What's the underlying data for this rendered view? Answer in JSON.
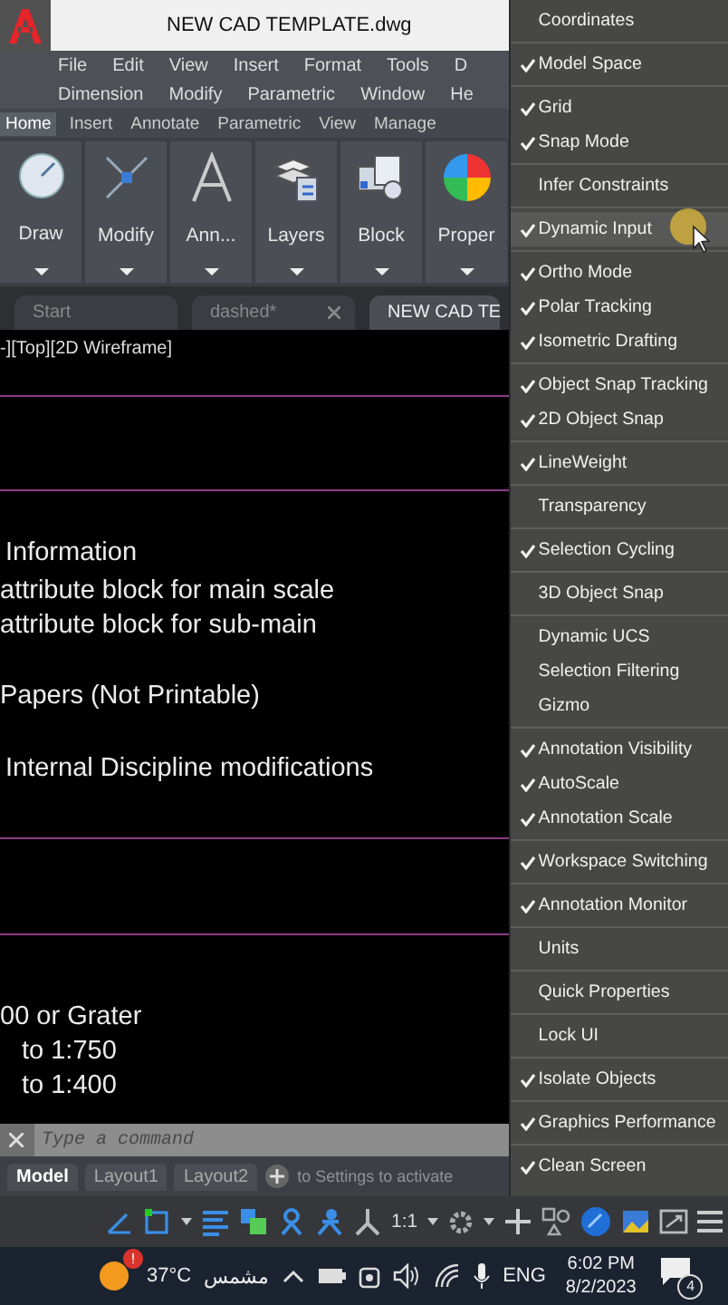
{
  "title_bar": {
    "title": "NEW CAD TEMPLATE.dwg"
  },
  "menu_rows": [
    {
      "items": [
        "File",
        "Edit",
        "View",
        "Insert",
        "Format",
        "Tools",
        "D"
      ]
    },
    {
      "items": [
        "Dimension",
        "Modify",
        "Parametric",
        "Window",
        "He"
      ]
    }
  ],
  "ribbon_tabs": [
    {
      "label": "Home",
      "selected": true
    },
    {
      "label": "Insert",
      "selected": false
    },
    {
      "label": "Annotate",
      "selected": false
    },
    {
      "label": "Parametric",
      "selected": false
    },
    {
      "label": "View",
      "selected": false
    },
    {
      "label": "Manage",
      "selected": false
    }
  ],
  "ribbon_panels": [
    {
      "label": "Draw",
      "kind": "draw"
    },
    {
      "label": "Modify",
      "kind": "modify"
    },
    {
      "label": "Ann...",
      "kind": "annotate"
    },
    {
      "label": "Layers",
      "kind": "layers"
    },
    {
      "label": "Block",
      "kind": "block"
    },
    {
      "label": "Proper",
      "kind": "properties"
    }
  ],
  "file_tabs": [
    {
      "label": "Start",
      "selected": false,
      "closable": false
    },
    {
      "label": "dashed*",
      "selected": false,
      "closable": true
    },
    {
      "label": "NEW CAD TE",
      "selected": true,
      "closable": false
    }
  ],
  "viewport": {
    "label": "-][Top][2D Wireframe]",
    "notes": [
      "Information",
      "attribute block for main scale",
      "attribute block for sub-main",
      "Papers (Not Printable)",
      "Internal Discipline modifications",
      "00 or Grater",
      "to 1:750",
      "to 1:400"
    ]
  },
  "command_line": {
    "placeholder": "Type a command"
  },
  "layout_tabs": [
    {
      "label": "Model",
      "selected": true
    },
    {
      "label": "Layout1",
      "selected": false
    },
    {
      "label": "Layout2",
      "selected": false
    }
  ],
  "activation_notice": "to Settings to activate",
  "status_bar": {
    "scale": "1:1"
  },
  "context_menu": {
    "groups": [
      {
        "items": [
          {
            "label": "Coordinates",
            "checked": false,
            "selected": false
          }
        ]
      },
      {
        "items": [
          {
            "label": "Model Space",
            "checked": true,
            "selected": false
          }
        ]
      },
      {
        "items": [
          {
            "label": "Grid",
            "checked": true,
            "selected": false
          },
          {
            "label": "Snap Mode",
            "checked": true,
            "selected": false
          }
        ]
      },
      {
        "items": [
          {
            "label": "Infer Constraints",
            "checked": false,
            "selected": false
          }
        ]
      },
      {
        "items": [
          {
            "label": "Dynamic Input",
            "checked": true,
            "selected": true
          }
        ]
      },
      {
        "items": [
          {
            "label": "Ortho Mode",
            "checked": true,
            "selected": false
          },
          {
            "label": "Polar Tracking",
            "checked": true,
            "selected": false
          },
          {
            "label": "Isometric Drafting",
            "checked": true,
            "selected": false
          }
        ]
      },
      {
        "items": [
          {
            "label": "Object Snap Tracking",
            "checked": true,
            "selected": false
          },
          {
            "label": "2D Object Snap",
            "checked": true,
            "selected": false
          }
        ]
      },
      {
        "items": [
          {
            "label": "LineWeight",
            "checked": true,
            "selected": false
          }
        ]
      },
      {
        "items": [
          {
            "label": "Transparency",
            "checked": false,
            "selected": false
          }
        ]
      },
      {
        "items": [
          {
            "label": "Selection Cycling",
            "checked": true,
            "selected": false
          }
        ]
      },
      {
        "items": [
          {
            "label": "3D Object Snap",
            "checked": false,
            "selected": false
          }
        ]
      },
      {
        "items": [
          {
            "label": "Dynamic UCS",
            "checked": false,
            "selected": false
          },
          {
            "label": "Selection Filtering",
            "checked": false,
            "selected": false
          },
          {
            "label": "Gizmo",
            "checked": false,
            "selected": false
          }
        ]
      },
      {
        "items": [
          {
            "label": "Annotation Visibility",
            "checked": true,
            "selected": false
          },
          {
            "label": "AutoScale",
            "checked": true,
            "selected": false
          },
          {
            "label": "Annotation Scale",
            "checked": true,
            "selected": false
          }
        ]
      },
      {
        "items": [
          {
            "label": "Workspace Switching",
            "checked": true,
            "selected": false
          }
        ]
      },
      {
        "items": [
          {
            "label": "Annotation Monitor",
            "checked": true,
            "selected": false
          }
        ]
      },
      {
        "items": [
          {
            "label": "Units",
            "checked": false,
            "selected": false
          }
        ]
      },
      {
        "items": [
          {
            "label": "Quick Properties",
            "checked": false,
            "selected": false
          }
        ]
      },
      {
        "items": [
          {
            "label": "Lock UI",
            "checked": false,
            "selected": false
          }
        ]
      },
      {
        "items": [
          {
            "label": "Isolate Objects",
            "checked": true,
            "selected": false
          }
        ]
      },
      {
        "items": [
          {
            "label": "Graphics Performance",
            "checked": true,
            "selected": false
          }
        ]
      },
      {
        "items": [
          {
            "label": "Clean Screen",
            "checked": true,
            "selected": false
          }
        ]
      }
    ]
  },
  "taskbar": {
    "weather_badge": "!",
    "temperature": "37°C",
    "weather": "مشمس",
    "language": "ENG",
    "time": "6:02 PM",
    "date": "8/2/2023",
    "notifications": "4"
  }
}
